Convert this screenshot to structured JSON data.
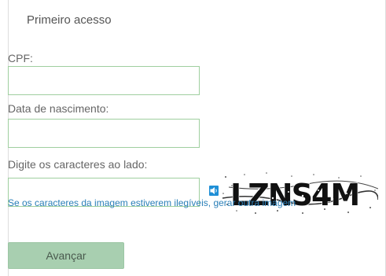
{
  "panel": {
    "title": "Primeiro acesso"
  },
  "fields": {
    "cpf": {
      "label": "CPF:",
      "value": "",
      "placeholder": ""
    },
    "birth_date": {
      "label": "Data de nascimento:",
      "value": "",
      "placeholder": ""
    },
    "captcha": {
      "label": "Digite os caracteres ao lado:",
      "value": "",
      "placeholder": ""
    }
  },
  "captcha_image": {
    "text": "LZNS4M",
    "icon": "audio-icon"
  },
  "hint": {
    "prefix": "Se os caracteres da imagem estiverem ilegíveis, ",
    "link": "gerar outra imagem"
  },
  "submit": {
    "label": "Avançar"
  },
  "colors": {
    "input_border": "#9fcf9f",
    "link": "#2a7fb8",
    "button_bg": "#a8cfb0",
    "audio_icon": "#1f8fd6"
  }
}
